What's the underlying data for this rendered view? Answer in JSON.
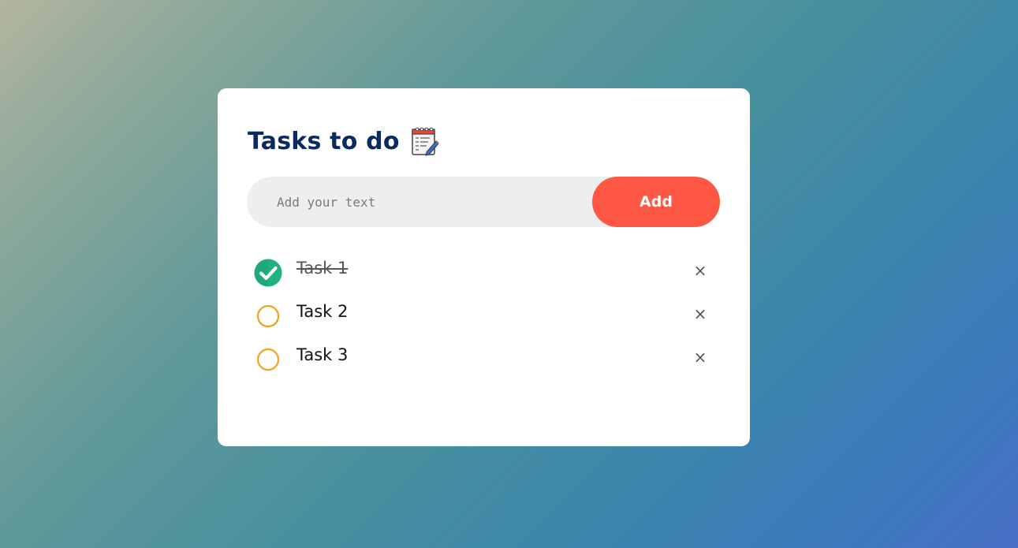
{
  "app": {
    "title": "Tasks to do",
    "title_icon": "notepad-icon"
  },
  "input": {
    "placeholder": "Add your text",
    "value": ""
  },
  "add_button": {
    "label": "Add"
  },
  "tasks": [
    {
      "label": "Task 1",
      "done": true,
      "delete_label": "×"
    },
    {
      "label": "Task 2",
      "done": false,
      "delete_label": "×"
    },
    {
      "label": "Task 3",
      "done": false,
      "delete_label": "×"
    }
  ],
  "colors": {
    "title": "#0b2a60",
    "accent": "#ff5945",
    "checked": "#1fa97a",
    "unchecked": "#f2a31a",
    "input_bg": "#edeef0"
  }
}
